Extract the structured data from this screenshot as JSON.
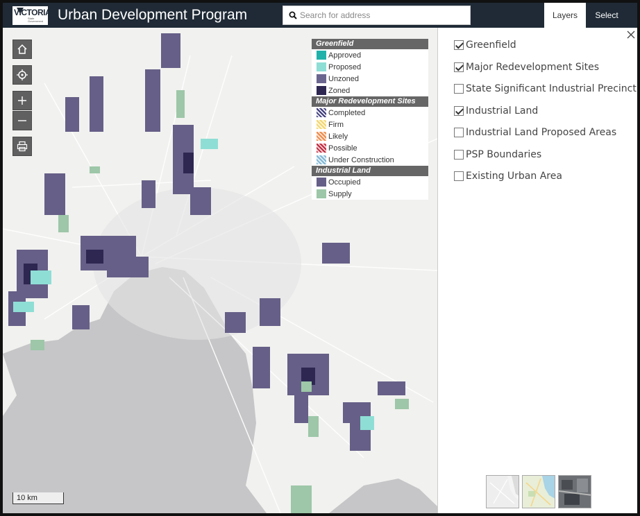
{
  "header": {
    "logo_text": "VICTORIA",
    "logo_sub": "State Government",
    "title": "Urban Development Program",
    "search_placeholder": "Search for address",
    "tabs": [
      {
        "label": "Layers"
      },
      {
        "label": "Select"
      }
    ]
  },
  "map": {
    "scale_label": "10 km",
    "controls": [
      "home-icon",
      "locate-icon",
      "zoom-in-icon",
      "zoom-out-icon",
      "print-icon"
    ]
  },
  "legend": {
    "sections": [
      {
        "title": "Greenfield",
        "items": [
          {
            "label": "Approved",
            "color": "#20b2aa"
          },
          {
            "label": "Proposed",
            "color": "#8fded5"
          },
          {
            "label": "Unzoned",
            "color": "#6b6690"
          },
          {
            "label": "Zoned",
            "color": "#2d2752"
          }
        ]
      },
      {
        "title": "Major Redevelopment Sites",
        "items": [
          {
            "label": "Completed",
            "color": "#3c3a7a"
          },
          {
            "label": "Firm",
            "color": "#f2d572"
          },
          {
            "label": "Likely",
            "color": "#ee8a4a"
          },
          {
            "label": "Possible",
            "color": "#c0283c"
          },
          {
            "label": "Under Construction",
            "color": "#7fb6d4"
          }
        ]
      },
      {
        "title": "Industrial Land",
        "items": [
          {
            "label": "Occupied",
            "color": "#665f87"
          },
          {
            "label": "Supply",
            "color": "#9dc7a8"
          }
        ]
      }
    ]
  },
  "panel": {
    "layers": [
      {
        "label": "Greenfield",
        "checked": true
      },
      {
        "label": "Major Redevelopment Sites",
        "checked": true
      },
      {
        "label": "State Significant Industrial Precinct",
        "checked": false
      },
      {
        "label": "Industrial Land",
        "checked": true
      },
      {
        "label": "Industrial Land Proposed Areas",
        "checked": false
      },
      {
        "label": "PSP Boundaries",
        "checked": false
      },
      {
        "label": "Existing Urban Area",
        "checked": false
      }
    ],
    "basemaps": [
      "basemap-light",
      "basemap-topographic",
      "basemap-imagery"
    ]
  }
}
